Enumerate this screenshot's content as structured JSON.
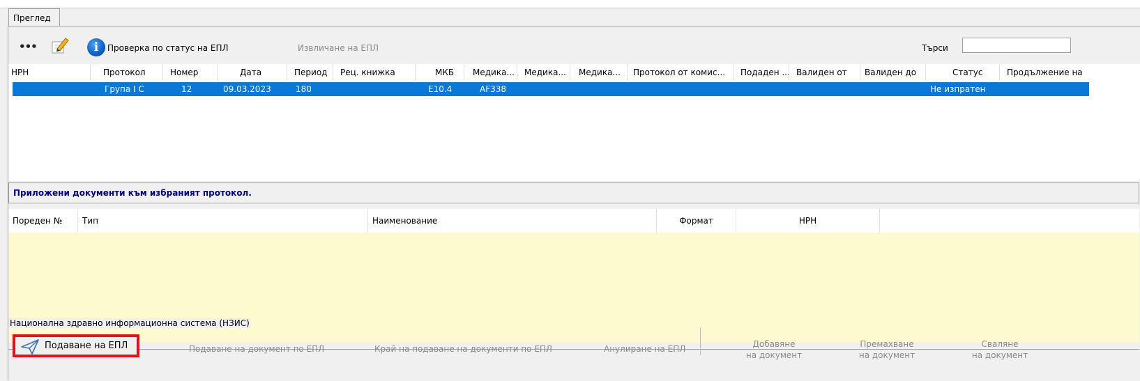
{
  "tab": {
    "label": "Преглед"
  },
  "toolbar": {
    "more_label": "•••",
    "check_status_label": "Проверка по статус на ЕПЛ",
    "extract_label": "Извличане на ЕПЛ",
    "search_label": "Търси",
    "search_value": ""
  },
  "protocols_table": {
    "columns": [
      "НРН",
      "Протокол",
      "Номер",
      "Дата",
      "Период",
      "Рец. книжка",
      "МКБ",
      "Медика...",
      "Медика...",
      "Медика...",
      "Протокол от комис...",
      "Подаден ...",
      "Валиден от",
      "Валиден до",
      "Статус",
      "Продължение на"
    ],
    "rows": [
      {
        "nrn": "",
        "protocol": "Група I C",
        "number": "12",
        "date": "09.03.2023",
        "period": "180",
        "recbook": "",
        "mkb": "E10.4",
        "med1": "AF338",
        "status": "Не изпратен"
      }
    ]
  },
  "attachments": {
    "title": "Приложени документи към избраният протокол.",
    "columns": [
      "Пореден №",
      "Тип",
      "Наименование",
      "Формат",
      "НРН"
    ]
  },
  "nzis": {
    "legend": "Национална здравно информационна система (НЗИС)",
    "submit_epl": "Подаване на  ЕПЛ",
    "submit_doc": "Подаване на документ по ЕПЛ",
    "end_submit_docs": "Край на подаване на документи по ЕПЛ",
    "annul_epl": "Анулиране на ЕПЛ",
    "add_doc_1": "Добавяне",
    "add_doc_2": "на документ",
    "remove_doc_1": "Премахване",
    "remove_doc_2": "на документ",
    "download_doc_1": "Сваляне",
    "download_doc_2": "на документ"
  },
  "colors": {
    "selection": "#0a78d7",
    "attachments_bg": "#fefad0",
    "highlight": "#e3101e",
    "title_blue": "#000080"
  },
  "icons": [
    "more-icon",
    "edit-icon",
    "info-icon",
    "send-plane-icon"
  ]
}
